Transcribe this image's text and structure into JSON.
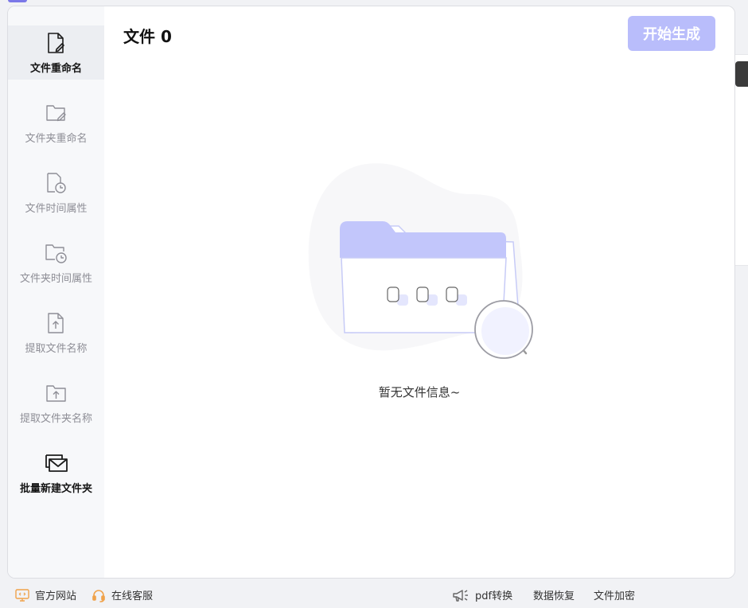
{
  "colors": {
    "accent": "#b9bdfb",
    "illustration_primary": "#c2c6fb",
    "sidebar_bg": "#f7f8fa",
    "active_item_bg": "#eceef2"
  },
  "sidebar": {
    "items": [
      {
        "label": "文件重命名",
        "icon": "file-edit-icon",
        "active": true
      },
      {
        "label": "文件夹重命名",
        "icon": "folder-edit-icon",
        "active": false
      },
      {
        "label": "文件时间属性",
        "icon": "file-clock-icon",
        "active": false
      },
      {
        "label": "文件夹时间属性",
        "icon": "folder-clock-icon",
        "active": false
      },
      {
        "label": "提取文件名称",
        "icon": "file-upload-icon",
        "active": false
      },
      {
        "label": "提取文件夹名称",
        "icon": "folder-upload-icon",
        "active": false
      },
      {
        "label": "批量新建文件夹",
        "icon": "mail-folders-icon",
        "active": false
      }
    ]
  },
  "main": {
    "file_count_label": "文件 0",
    "start_button": "开始生成",
    "empty_text": "暂无文件信息~"
  },
  "footer": {
    "website": "官方网站",
    "support": "在线客服",
    "pdf": "pdf转换",
    "recovery": "数据恢复",
    "encrypt": "文件加密"
  }
}
